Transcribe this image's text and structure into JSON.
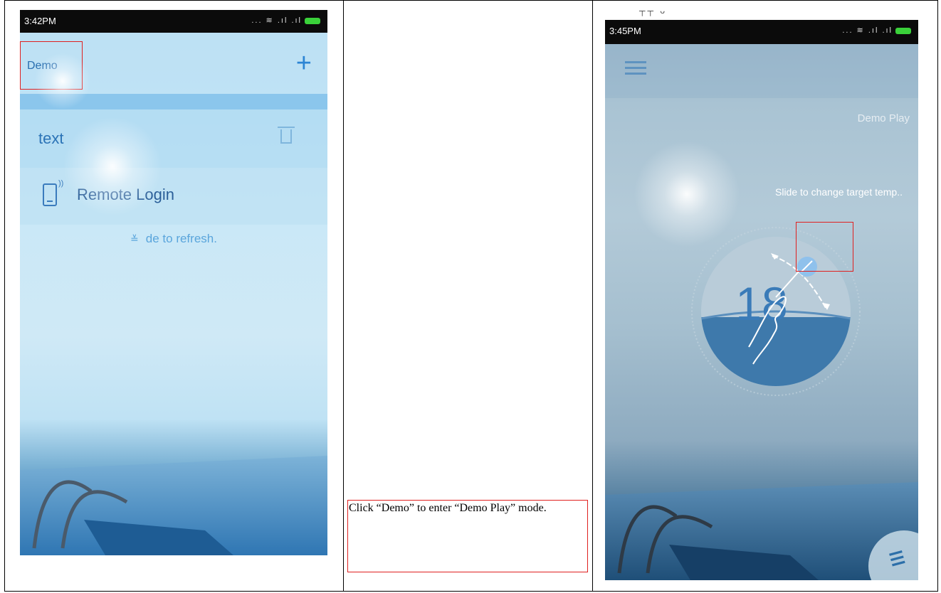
{
  "left_phone": {
    "status_time": "3:42PM",
    "status_icons": "... ≋ .ıl .ıl",
    "demo_label": "Demo",
    "add_symbol": "+",
    "list_item": "text",
    "remote_login": "Remote Login",
    "refresh_hint": "de to refresh."
  },
  "caption": {
    "text": "Click “Demo” to enter “Demo Play” mode."
  },
  "right_phone": {
    "top_marks": "┬┬ ᴗ",
    "status_time": "3:45PM",
    "status_icons": "... ≋ .ıl .ıl",
    "mode_label": "Demo Play",
    "slide_hint": "Slide to change target temp..",
    "temperature": "18"
  },
  "colors": {
    "highlight_box": "#e0201f",
    "accent_blue": "#2d85d4"
  }
}
